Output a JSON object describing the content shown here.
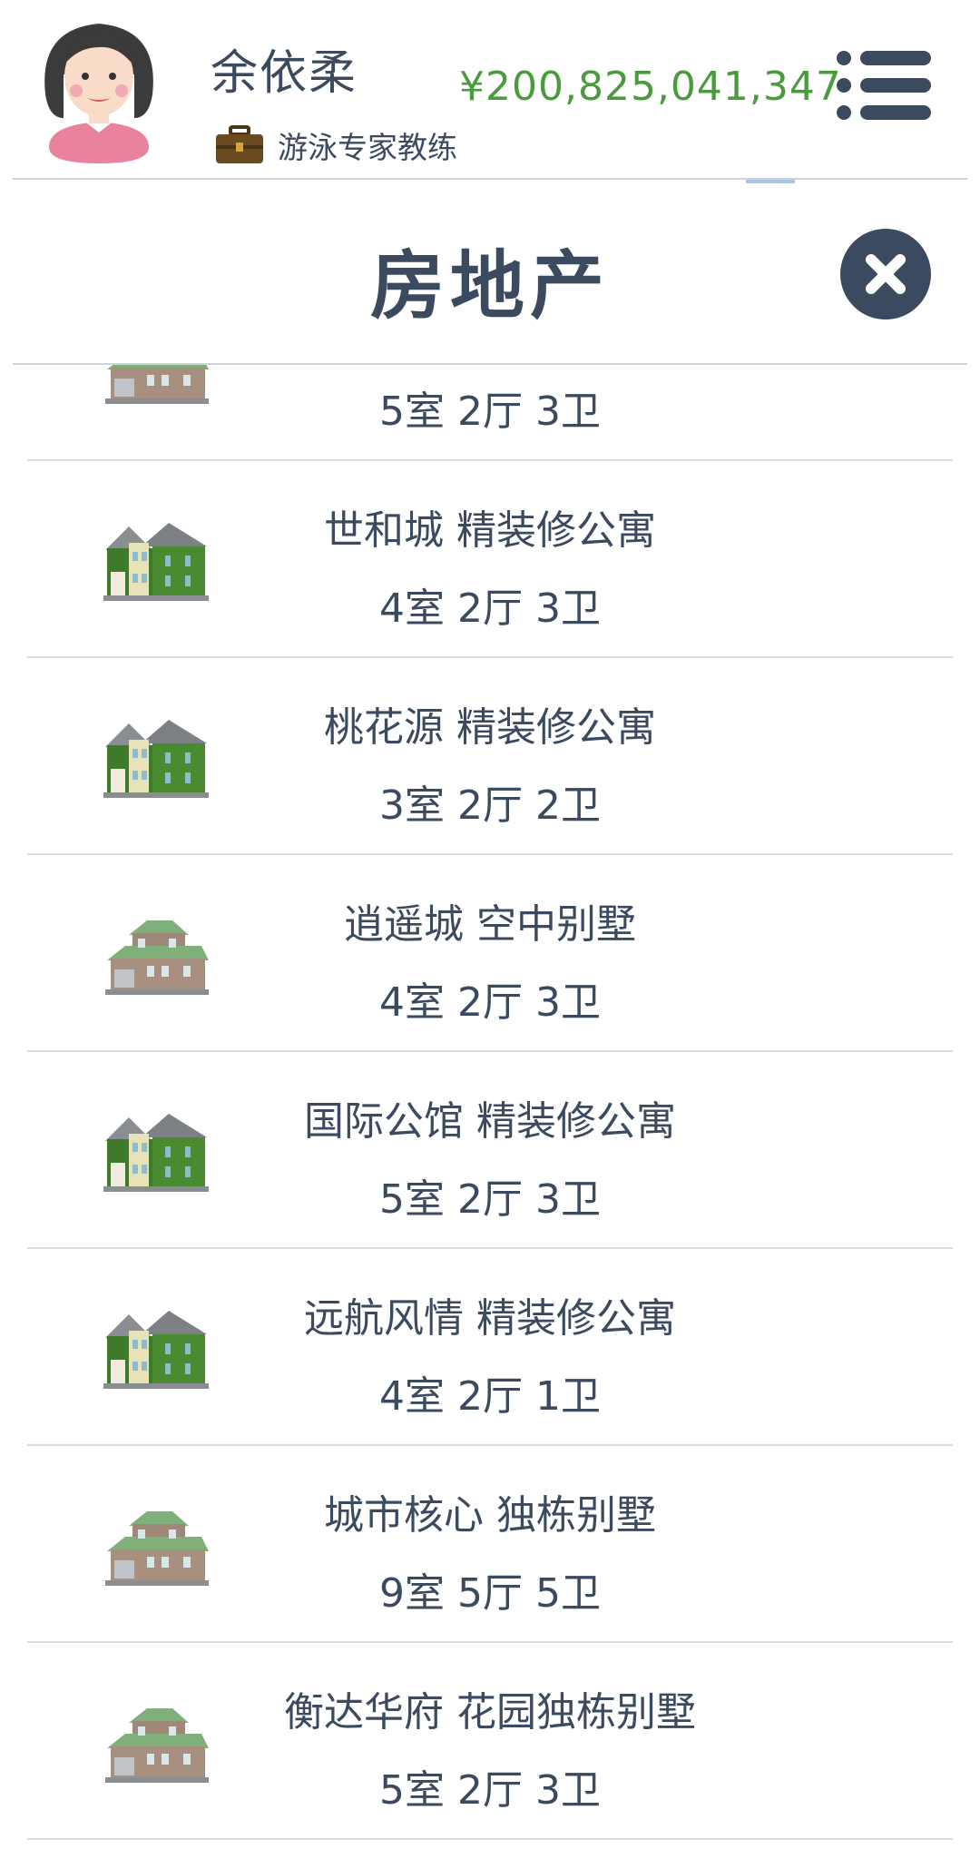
{
  "header": {
    "user_name": "余依柔",
    "job_title": "游泳专家教练",
    "money": "¥200,825,041,347",
    "money_color": "#4a9a3e"
  },
  "panel": {
    "title": "房地产",
    "close_icon": "close-icon"
  },
  "properties": [
    {
      "title": "",
      "rooms": "5室 2厅 3卫",
      "icon": "villa-house-icon"
    },
    {
      "title": "世和城 精装修公寓",
      "rooms": "4室 2厅 3卫",
      "icon": "apartment-house-icon"
    },
    {
      "title": "桃花源 精装修公寓",
      "rooms": "3室 2厅 2卫",
      "icon": "apartment-house-icon"
    },
    {
      "title": "逍遥城 空中别墅",
      "rooms": "4室 2厅 3卫",
      "icon": "villa-house-icon"
    },
    {
      "title": "国际公馆 精装修公寓",
      "rooms": "5室 2厅 3卫",
      "icon": "apartment-house-icon"
    },
    {
      "title": "远航风情 精装修公寓",
      "rooms": "4室 2厅 1卫",
      "icon": "apartment-house-icon"
    },
    {
      "title": "城市核心 独栋别墅",
      "rooms": "9室 5厅 5卫",
      "icon": "villa-house-icon"
    },
    {
      "title": "衡达华府 花园独栋别墅",
      "rooms": "5室 2厅 3卫",
      "icon": "villa-house-icon"
    }
  ]
}
